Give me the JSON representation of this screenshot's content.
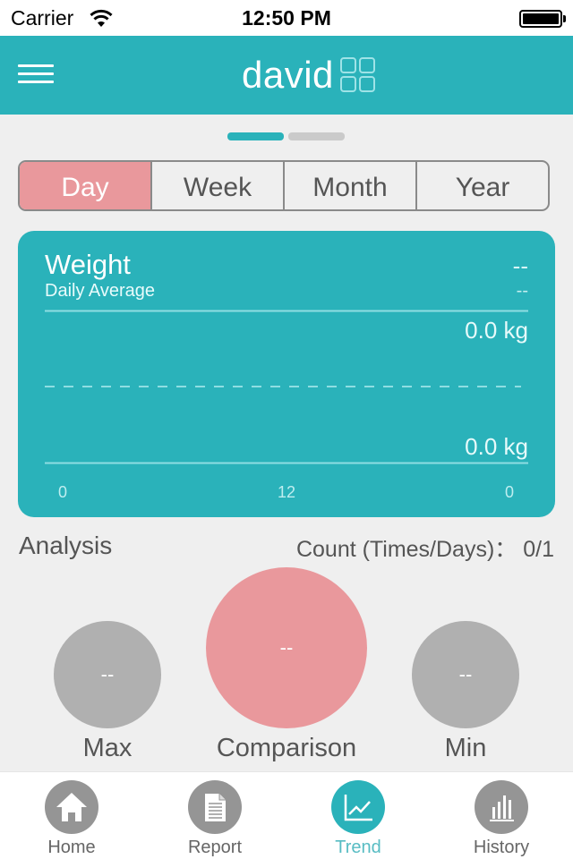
{
  "status_bar": {
    "carrier": "Carrier",
    "time": "12:50 PM",
    "wifi_icon": "wifi-icon",
    "battery_icon": "battery-full-icon"
  },
  "header": {
    "title": "david",
    "menu_icon": "hamburger-menu-icon",
    "grid_icon": "grid-four-squares-icon",
    "background_color": "#2ab2ba"
  },
  "pager": {
    "pages": 2,
    "current_page": 1
  },
  "period_tabs": {
    "items": [
      {
        "label": "Day",
        "active": true
      },
      {
        "label": "Week",
        "active": false
      },
      {
        "label": "Month",
        "active": false
      },
      {
        "label": "Year",
        "active": false
      }
    ],
    "active_color": "#e9989c"
  },
  "chart_card": {
    "title": "Weight",
    "subtitle": "Daily Average",
    "value_primary": "--",
    "value_secondary": "--",
    "max_label": "0.0 kg",
    "min_label": "0.0 kg",
    "x_ticks": [
      "0",
      "12",
      "0"
    ]
  },
  "chart_data": {
    "type": "line",
    "title": "Weight",
    "subtitle": "Daily Average",
    "xlabel": "",
    "ylabel": "kg",
    "x_tick_labels": [
      "0",
      "12",
      "0"
    ],
    "y_max_label": "0.0 kg",
    "y_min_label": "0.0 kg",
    "ylim": [
      0.0,
      0.0
    ],
    "reference_line": "average (dashed)",
    "series": [
      {
        "name": "Weight",
        "values": []
      }
    ],
    "grid": false,
    "legend": "none"
  },
  "analysis": {
    "title": "Analysis",
    "count_label": "Count (Times/Days)： 0/1",
    "metrics": [
      {
        "label": "Max",
        "value": "--",
        "color": "#b0b0b0"
      },
      {
        "label": "Comparison",
        "value": "--",
        "color": "#e9989c"
      },
      {
        "label": "Min",
        "value": "--",
        "color": "#b0b0b0"
      }
    ]
  },
  "tab_bar": {
    "items": [
      {
        "label": "Home",
        "icon": "home-icon",
        "active": false
      },
      {
        "label": "Report",
        "icon": "document-icon",
        "active": false
      },
      {
        "label": "Trend",
        "icon": "line-chart-icon",
        "active": true
      },
      {
        "label": "History",
        "icon": "bar-chart-icon",
        "active": false
      }
    ],
    "active_color": "#2ab2ba"
  }
}
